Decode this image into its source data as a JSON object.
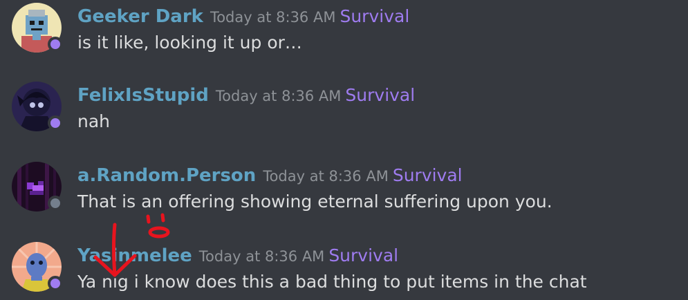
{
  "messages": [
    {
      "username": "Geeker Dark",
      "timestamp": "Today at 8:36 AM",
      "role": "Survival",
      "content": "is it like, looking it up or…",
      "status": "streaming",
      "avatar_icon": "robot-avatar"
    },
    {
      "username": "FelixIsStupid",
      "timestamp": "Today at 8:36 AM",
      "role": "Survival",
      "content": "nah",
      "status": "streaming",
      "avatar_icon": "dark-character-avatar"
    },
    {
      "username": "a.Random.Person",
      "timestamp": "Today at 8:36 AM",
      "role": "Survival",
      "content": "That is an offering showing eternal suffering upon you.",
      "status": "offline",
      "avatar_icon": "pixel-art-avatar"
    },
    {
      "username": "Yasinmelee",
      "timestamp": "Today at 8:36 AM",
      "role": "Survival",
      "content": "Ya nig i know does this a bad thing to put items in the chat",
      "status": "streaming",
      "avatar_icon": "blue-alien-avatar"
    }
  ],
  "colors": {
    "background": "#36393f",
    "username": "#5fa3c4",
    "timestamp": "#8e9297",
    "role": "#9f7cf0",
    "message_text": "#dcddde",
    "status_streaming": "#9f7cf0",
    "status_offline": "#747f8d",
    "annotation": "#e8141e"
  }
}
